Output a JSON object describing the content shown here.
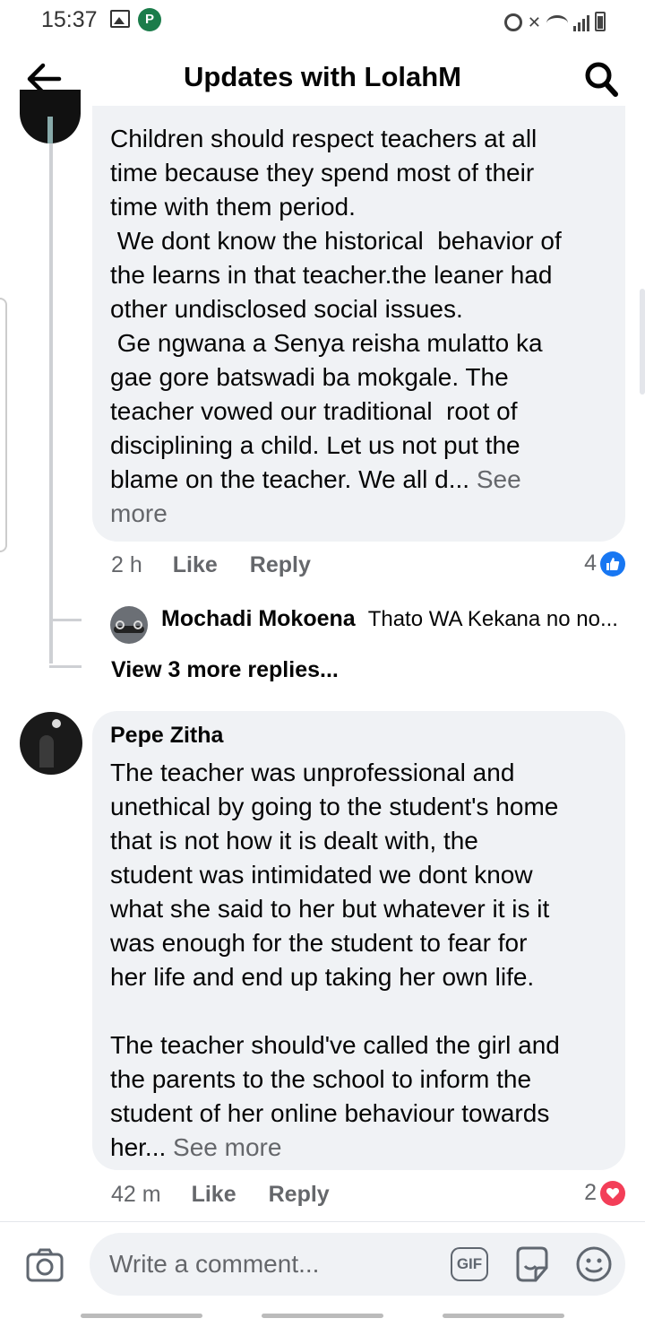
{
  "status_bar": {
    "time": "15:37"
  },
  "header": {
    "title": "Updates with LolahM"
  },
  "comment1": {
    "text": "Children should respect teachers at all\ntime because they spend most of their\ntime with them period.\n We dont know the historical  behavior of\nthe learns in that teacher.the leaner had\nother undisclosed social issues.\n Ge ngwana a Senya reisha mulatto ka\ngae gore batswadi ba mokgale. The\nteacher vowed our traditional  root of\ndisciplining a child. Let us not put the\nblame on the teacher. We all d... ",
    "see_more": "See\nmore",
    "time": "2 h",
    "like": "Like",
    "reply": "Reply",
    "reaction_count": "4"
  },
  "reply_preview": {
    "author": "Mochadi Mokoena",
    "snippet": "Thato WA Kekana no no..."
  },
  "view_more": "View 3 more replies...",
  "comment2": {
    "author": "Pepe Zitha",
    "text": "The teacher was unprofessional and\nunethical by going to the student's home\nthat is not how it is dealt with, the\nstudent was intimidated we dont know\nwhat she said to her but whatever it is it\nwas enough for the student to fear for\nher life and end up taking her own life.\n\nThe teacher should've called the girl and\nthe parents to the school to inform the\nstudent of her online behaviour towards\nher... ",
    "see_more": "See more",
    "time": "42 m",
    "like": "Like",
    "reply": "Reply",
    "reaction_count": "2"
  },
  "composer": {
    "placeholder": "Write a comment...",
    "gif_label": "GIF"
  },
  "colors": {
    "accent": "#1877f2",
    "love": "#f33e58",
    "bubble": "#f0f2f5",
    "muted": "#65676b"
  }
}
